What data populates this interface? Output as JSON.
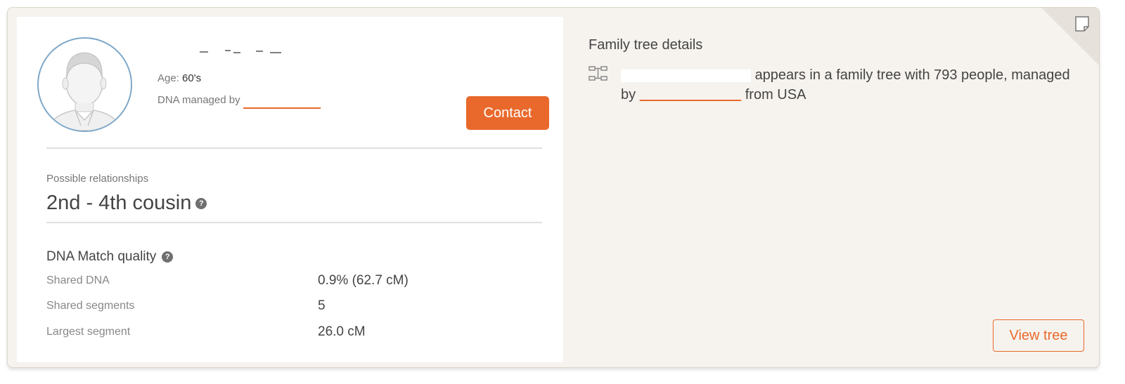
{
  "profile": {
    "age_label": "Age:",
    "age_value": "60's",
    "managed_label": "DNA managed by",
    "contact_label": "Contact"
  },
  "relationship": {
    "label": "Possible relationships",
    "value": "2nd - 4th cousin",
    "help": "?"
  },
  "match_quality": {
    "title": "DNA Match quality",
    "help": "?",
    "rows": [
      {
        "label": "Shared DNA",
        "value": "0.9% (62.7 cM)"
      },
      {
        "label": "Shared segments",
        "value": "5"
      },
      {
        "label": "Largest segment",
        "value": "26.0 cM"
      }
    ]
  },
  "family_tree": {
    "title": "Family tree details",
    "text_after_name": "appears in a family tree with 793 people, managed by",
    "text_end": "from USA",
    "view_tree_label": "View tree"
  },
  "colors": {
    "accent": "#e9692c",
    "avatar_ring": "#7ea8c9",
    "panel_bg": "#f6f3ee"
  },
  "icons": {
    "avatar": "person-silhouette-icon",
    "help": "question-mark-icon",
    "tree": "family-tree-icon",
    "note": "note-icon"
  }
}
